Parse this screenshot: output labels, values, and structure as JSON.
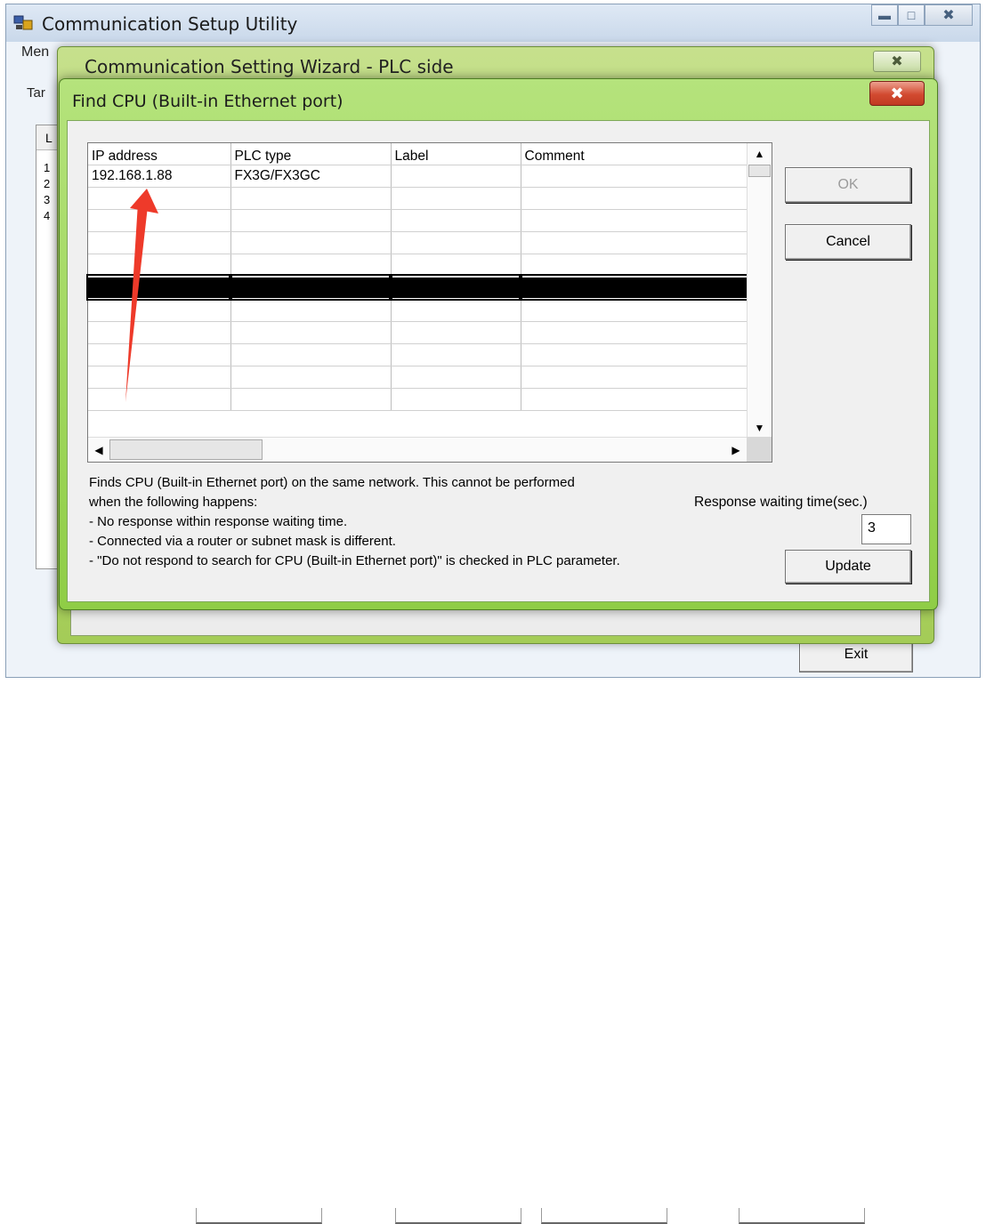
{
  "main_window": {
    "title": "Communication Setup Utility",
    "menu_label": "Men",
    "tab_label": "Tar",
    "list_header": "L",
    "list_rows": [
      "1",
      "2",
      "3",
      "4"
    ],
    "exit_label": "Exit"
  },
  "wizard": {
    "title": "Communication Setting Wizard - PLC side"
  },
  "dialog": {
    "title": "Find CPU (Built-in Ethernet port)",
    "columns": [
      "IP address",
      "PLC type",
      "Label",
      "Comment"
    ],
    "rows": [
      {
        "ip": "192.168.1.88",
        "plc_type": "FX3G/FX3GC",
        "label": "",
        "comment": ""
      }
    ],
    "ok_label": "OK",
    "cancel_label": "Cancel",
    "update_label": "Update",
    "info_lines": [
      "Finds CPU (Built-in Ethernet port) on the same network. This cannot be performed",
      "when the following happens:",
      "- No response within response waiting time.",
      "- Connected via a router or subnet mask is different.",
      "- \"Do not respond to search for CPU (Built-in Ethernet port)\" is checked in PLC parameter."
    ],
    "response_label": "Response waiting time(sec.)",
    "response_value": "3"
  },
  "colors": {
    "dialog_frame": "#8fcd46",
    "close_red": "#d24a30",
    "arrow": "#ee3a2a"
  },
  "icons": {
    "app": "network-computer-icon",
    "close": "close-icon",
    "minimize": "minimize-icon",
    "maximize": "maximize-icon"
  }
}
